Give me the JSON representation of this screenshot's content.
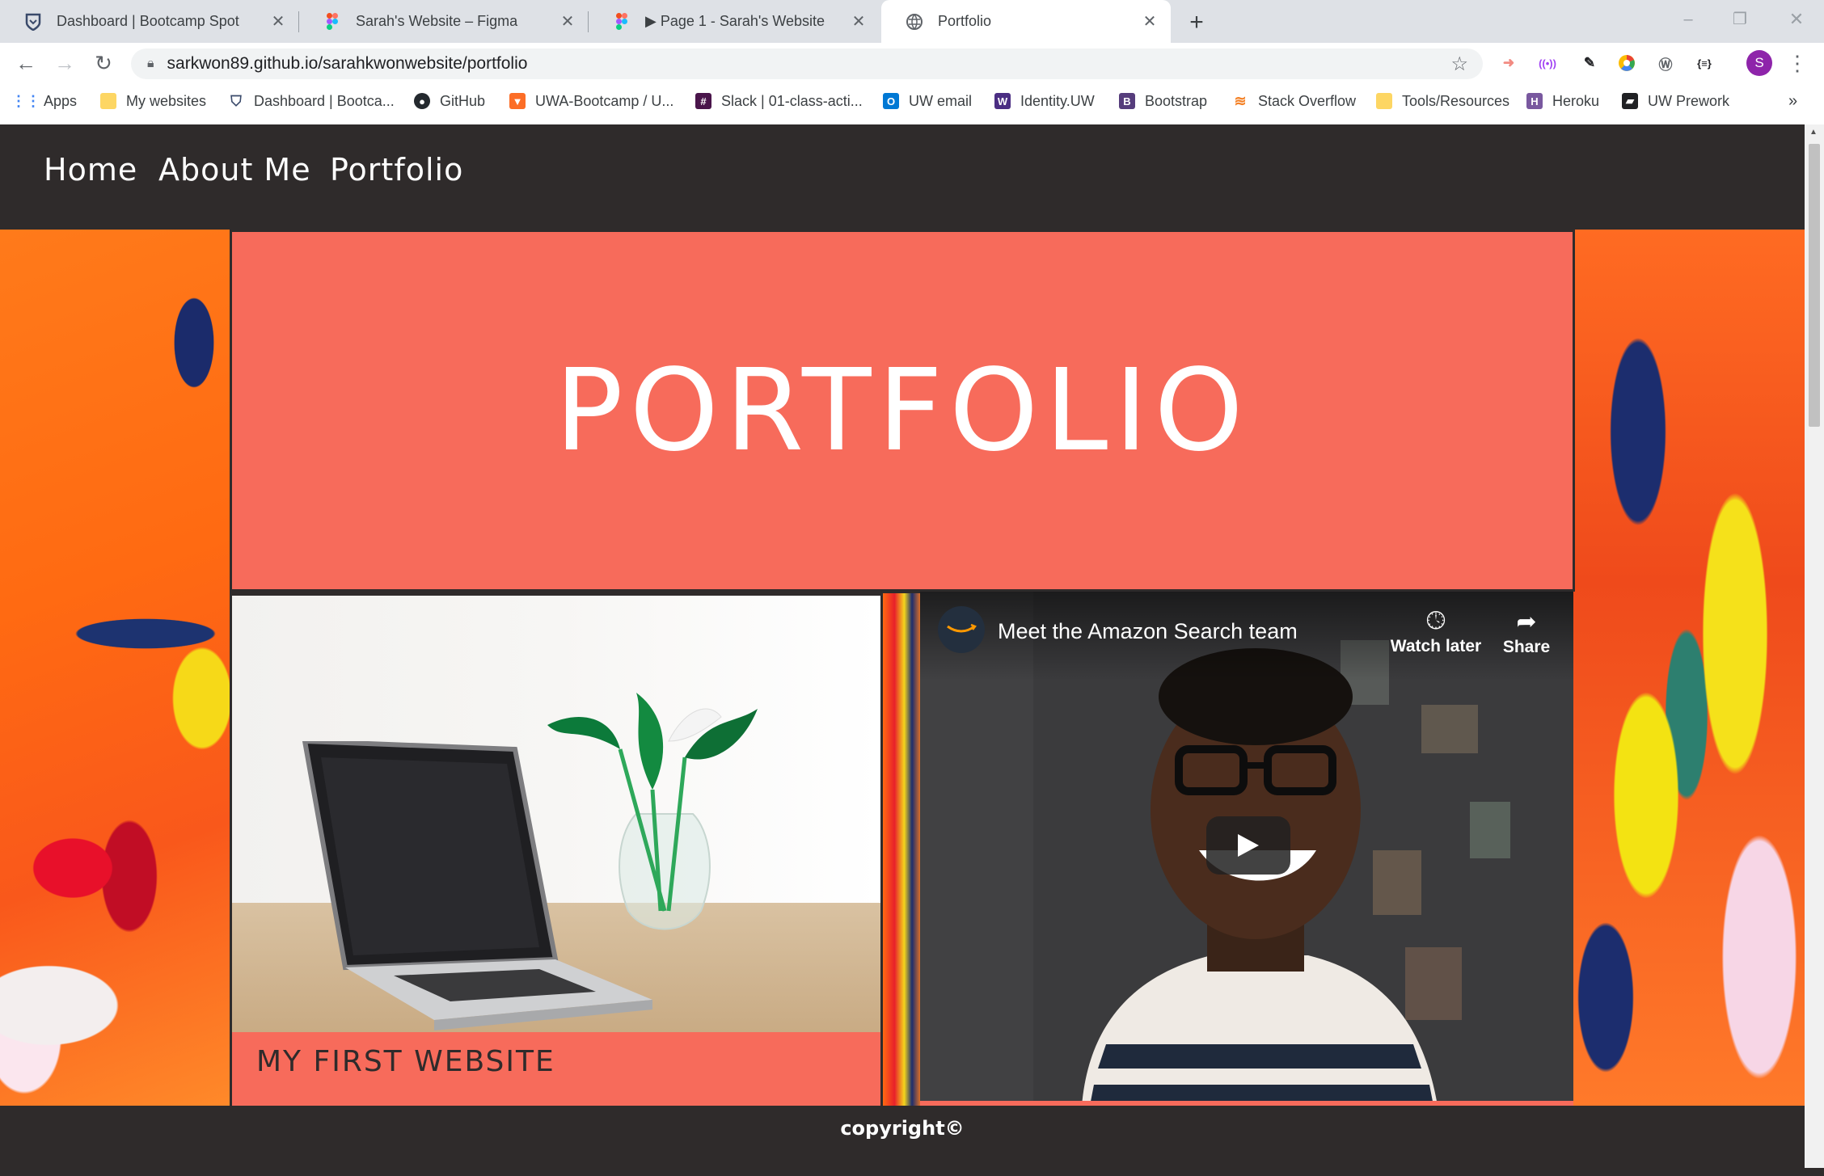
{
  "tabs": [
    {
      "title": "Dashboard | Bootcamp Spot",
      "icon": "bootcamp-shield-icon"
    },
    {
      "title": "Sarah's Website – Figma",
      "icon": "figma-icon"
    },
    {
      "title": "▶ Page 1 - Sarah's Website",
      "icon": "figma-icon"
    },
    {
      "title": "Portfolio",
      "icon": "globe-icon",
      "active": true
    }
  ],
  "address_bar": {
    "url": "sarkwon89.github.io/sarahkwonwebsite/portfolio"
  },
  "profile": {
    "initial": "S",
    "color": "#8e24aa"
  },
  "bookmarks": [
    {
      "label": "Apps",
      "icon": "apps-grid-icon"
    },
    {
      "label": "My websites",
      "icon": "folder-icon"
    },
    {
      "label": "Dashboard | Bootca...",
      "icon": "bootcamp-shield-icon"
    },
    {
      "label": "GitHub",
      "icon": "github-icon"
    },
    {
      "label": "UWA-Bootcamp / U...",
      "icon": "gitlab-icon"
    },
    {
      "label": "Slack | 01-class-acti...",
      "icon": "slack-icon"
    },
    {
      "label": "UW email",
      "icon": "outlook-icon"
    },
    {
      "label": "Identity.UW",
      "icon": "uw-icon"
    },
    {
      "label": "Bootstrap",
      "icon": "bootstrap-icon"
    },
    {
      "label": "Stack Overflow",
      "icon": "stackoverflow-icon"
    },
    {
      "label": "Tools/Resources",
      "icon": "folder-icon"
    },
    {
      "label": "Heroku",
      "icon": "heroku-icon"
    },
    {
      "label": "UW Prework",
      "icon": "book-icon"
    }
  ],
  "site": {
    "nav": [
      "Home",
      "About Me",
      "Portfolio"
    ],
    "hero_title": "PORTFOLIO",
    "card1_title": "MY FIRST WEBSITE",
    "video": {
      "title": "Meet the Amazon Search team",
      "watch_later": "Watch later",
      "share": "Share"
    },
    "footer": "copyright©"
  },
  "colors": {
    "accent": "#f76b5b",
    "dark": "#2f2b2b"
  }
}
